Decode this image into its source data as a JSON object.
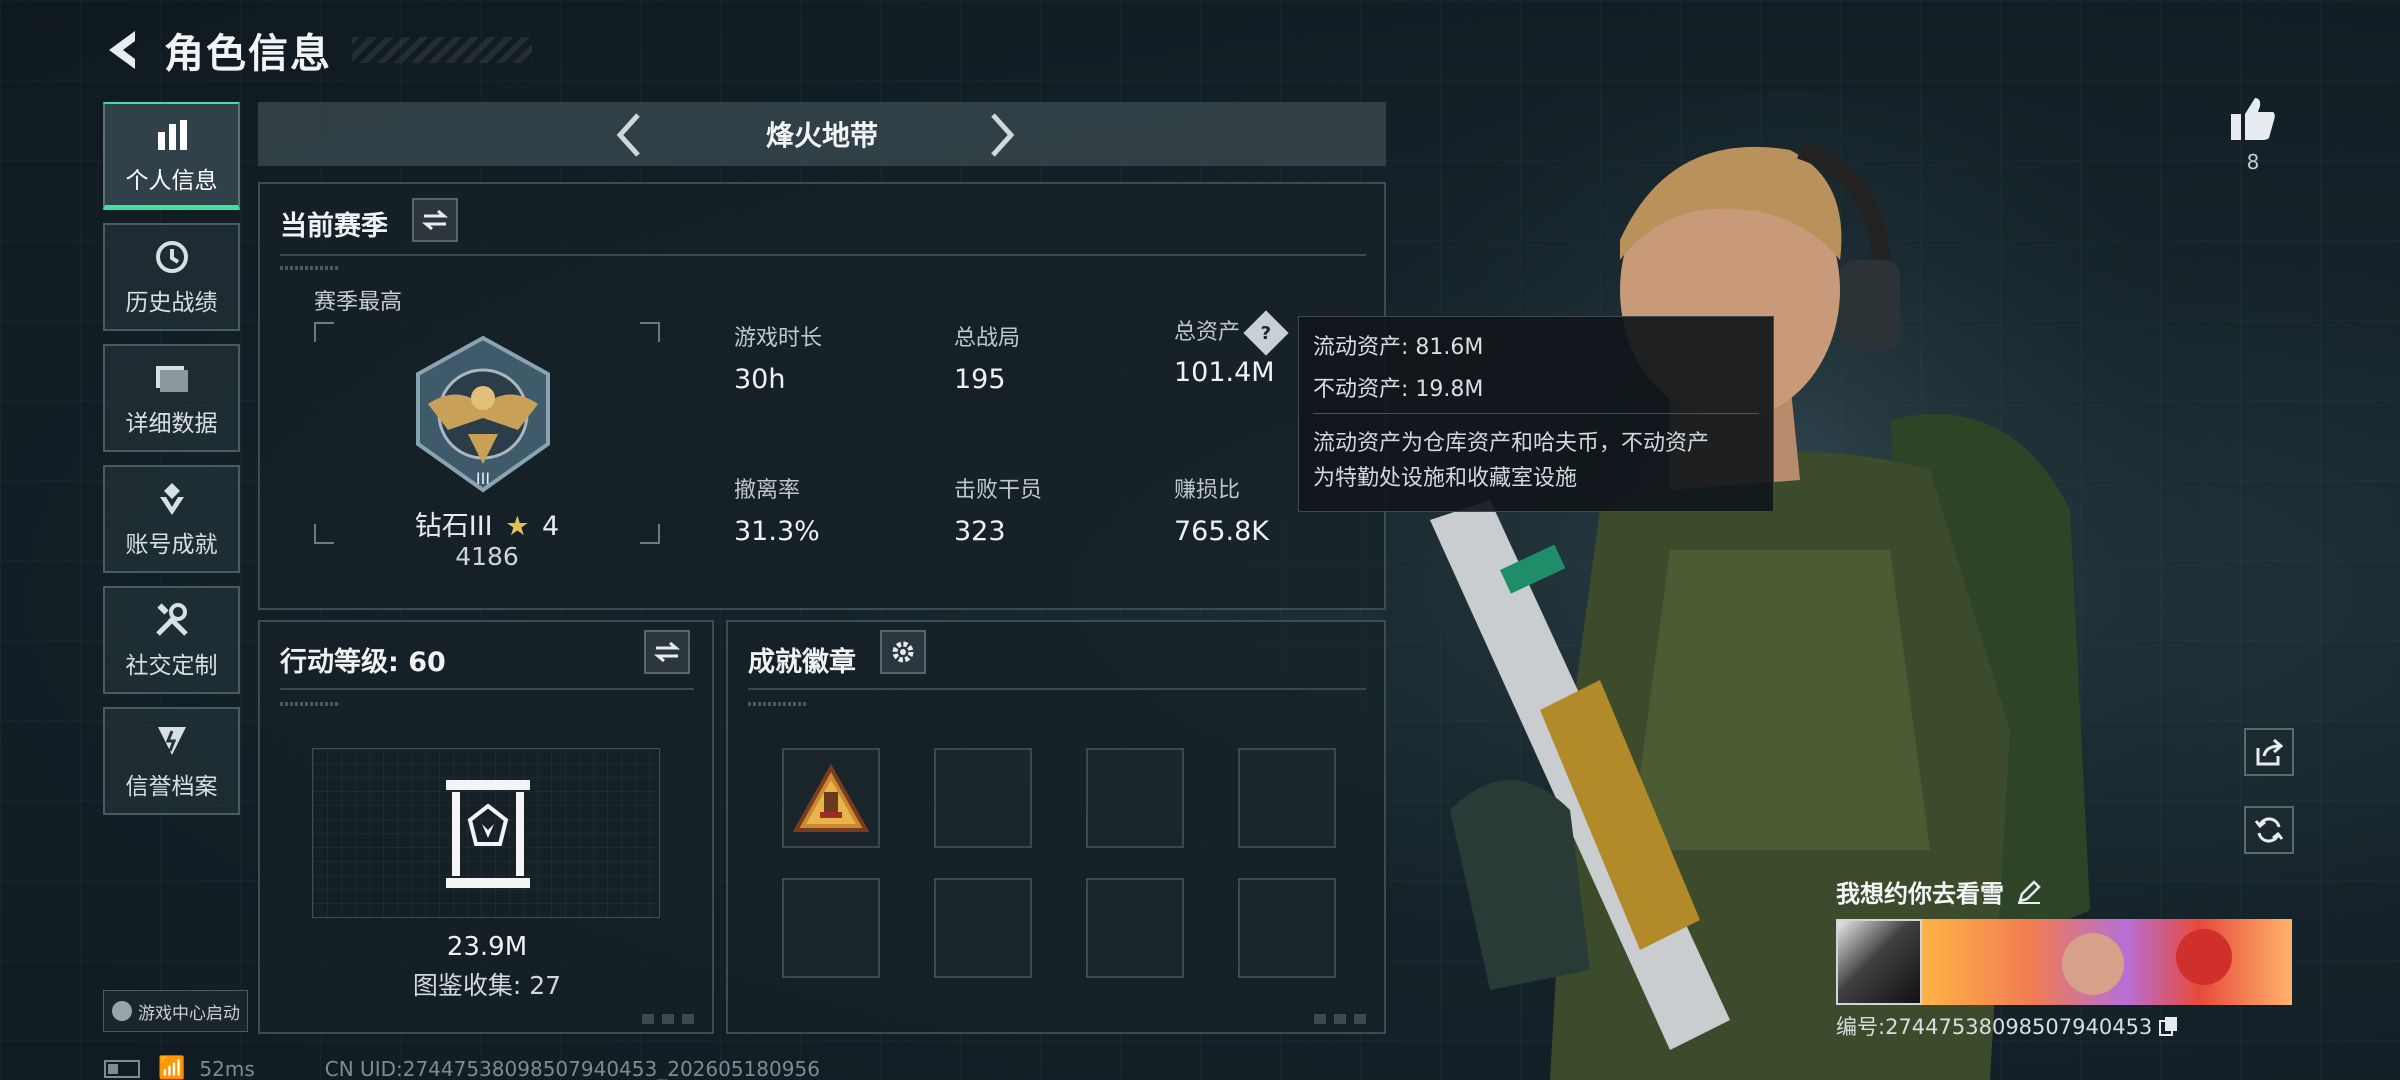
{
  "header": {
    "title": "角色信息"
  },
  "nav": {
    "items": [
      {
        "label": "个人信息",
        "icon": "bar-chart-icon",
        "active": true
      },
      {
        "label": "历史战绩",
        "icon": "history-icon",
        "active": false
      },
      {
        "label": "详细数据",
        "icon": "folder-icon",
        "active": false
      },
      {
        "label": "账号成就",
        "icon": "achievement-icon",
        "active": false
      },
      {
        "label": "社交定制",
        "icon": "tools-icon",
        "active": false
      },
      {
        "label": "信誉档案",
        "icon": "credit-icon",
        "active": false
      }
    ]
  },
  "mode": {
    "name": "烽火地带"
  },
  "season": {
    "title": "当前赛季",
    "best_label": "赛季最高",
    "rank_name": "钻石III",
    "rank_stars": "4",
    "rank_score": "4186",
    "stats": [
      {
        "label": "游戏时长",
        "value": "30h"
      },
      {
        "label": "总战局",
        "value": "195"
      },
      {
        "label": "总资产",
        "value": "101.4M"
      },
      {
        "label": "撤离率",
        "value": "31.3%"
      },
      {
        "label": "击败干员",
        "value": "323"
      },
      {
        "label": "赚损比",
        "value": "765.8K"
      }
    ]
  },
  "tooltip": {
    "liquid": "流动资产: 81.6M",
    "fixed": "不动资产: 19.8M",
    "desc_line1": "流动资产为仓库资产和哈夫币，不动资产",
    "desc_line2": "为特勤处设施和收藏室设施"
  },
  "action_level": {
    "title": "行动等级: 60",
    "value": "23.9M",
    "collection": "图鉴收集: 27"
  },
  "badges": {
    "title": "成就徽章"
  },
  "likes": {
    "count": "8"
  },
  "player": {
    "name": "我想约你去看雪",
    "id": "编号:27447538098507940453"
  },
  "launch_badge": {
    "label": "游戏中心启动"
  },
  "status": {
    "ping": "52ms",
    "uid": "CN UID:27447538098507940453_202605180956"
  },
  "colors": {
    "accent": "#3de2a0",
    "panel": "#16212a"
  }
}
